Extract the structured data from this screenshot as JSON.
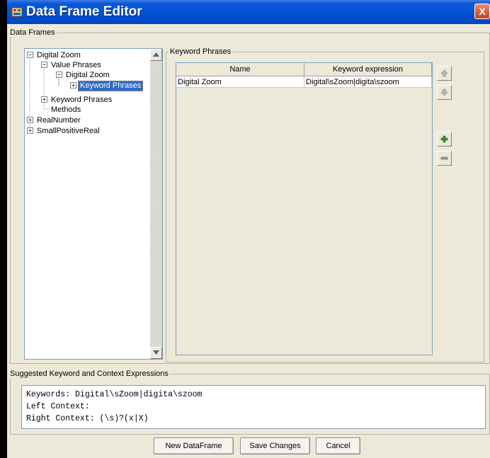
{
  "window": {
    "title": "Data Frame Editor",
    "close_glyph": "X"
  },
  "data_frames": {
    "legend": "Data Frames",
    "tree": [
      {
        "label": "Digital Zoom",
        "expander": "−"
      },
      {
        "label": "Value Phrases",
        "expander": "−"
      },
      {
        "label": "Digital Zoom",
        "expander": "−"
      },
      {
        "label": "Keyword Phrases",
        "expander": "+",
        "selected": true
      },
      {
        "label": "Keyword Phrases",
        "expander": "+"
      },
      {
        "label": "Methods",
        "expander": ""
      },
      {
        "label": "RealNumber",
        "expander": "+"
      },
      {
        "label": "SmallPositiveReal",
        "expander": "+"
      }
    ]
  },
  "keyword_phrases": {
    "legend": "Keyword Phrases",
    "columns": [
      "Name",
      "Keyword expression"
    ],
    "rows": [
      {
        "name": "Digital Zoom",
        "expression": "Digital\\sZoom|digita\\szoom"
      }
    ]
  },
  "suggested": {
    "legend": "Suggested Keyword and Context Expressions",
    "lines": [
      "Keywords: Digital\\sZoom|digita\\szoom",
      "Left Context:",
      "Right Context: (\\s)?(x|X)"
    ]
  },
  "buttons": {
    "new_dataframe": "New DataFrame",
    "save_changes": "Save Changes",
    "cancel": "Cancel"
  },
  "colors": {
    "titlebar": "#0050d0",
    "selection": "#316ac5",
    "add_icon": "#2e9a2e"
  }
}
